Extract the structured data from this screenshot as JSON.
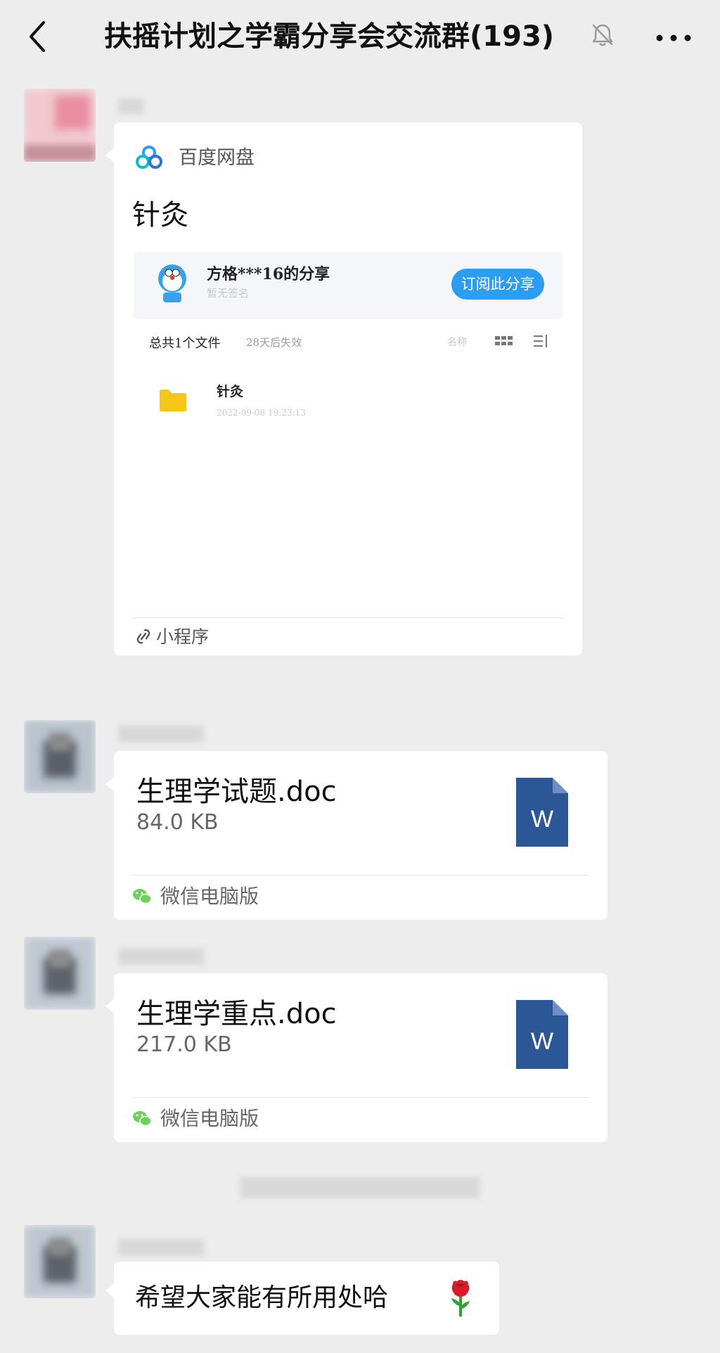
{
  "header": {
    "title": "扶摇计划之学霸分享会交流群(193)"
  },
  "messages": [
    {
      "type": "miniprogram",
      "app_name": "百度网盘",
      "title": "针灸",
      "share": {
        "user": "方格***16的分享",
        "subtitle": "暂无签名",
        "subscribe_label": "订阅此分享",
        "summary": "总共1个文件",
        "expiry": "28天后失效",
        "sort_label": "名称",
        "folder_name": "针灸",
        "folder_date": "2022-09-08 19:23:13"
      },
      "footer_label": "小程序"
    },
    {
      "type": "file",
      "file_name": "生理学试题.doc",
      "file_size": "84.0 KB",
      "source": "微信电脑版"
    },
    {
      "type": "file",
      "file_name": "生理学重点.doc",
      "file_size": "217.0 KB",
      "source": "微信电脑版"
    },
    {
      "type": "text",
      "text": "希望大家能有所用处哈",
      "emoji": "rose-emoji"
    }
  ],
  "icons": {
    "back": "chevron-left-icon",
    "mute": "bell-off-icon",
    "more": "more-dots-icon",
    "baidu": "baidu-netdisk-logo",
    "word": "word-doc-icon",
    "wechat": "wechat-icon",
    "link": "link-icon"
  },
  "colors": {
    "background": "#ededed",
    "bubble": "#ffffff",
    "subscribe_button": "#2b9ef3",
    "word_icon": "#2b5797",
    "folder": "#f5c518"
  }
}
